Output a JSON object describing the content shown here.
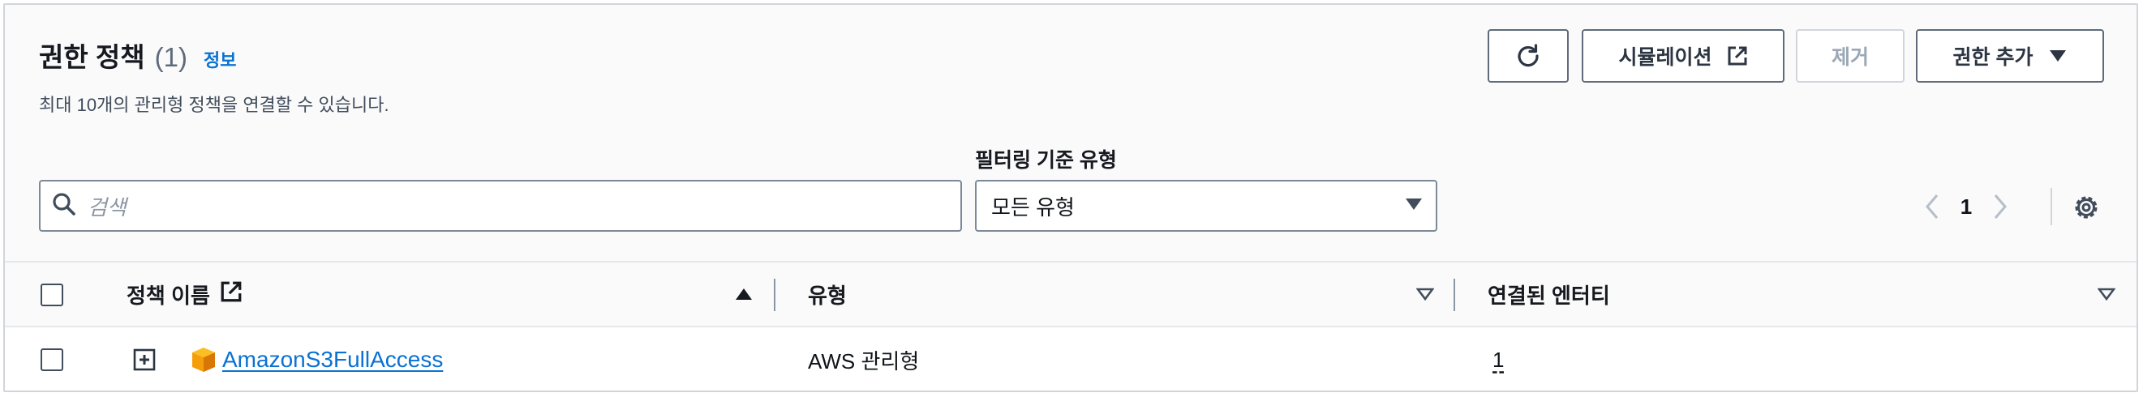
{
  "header": {
    "title": "권한 정책",
    "count": "(1)",
    "info_link": "정보",
    "description": "최대 10개의 관리형 정책을 연결할 수 있습니다."
  },
  "actions": {
    "refresh_icon": "refresh-icon",
    "simulation_label": "시뮬레이션",
    "remove_label": "제거",
    "add_label": "권한 추가"
  },
  "filter": {
    "search_placeholder": "검색",
    "type_label": "필터링 기준 유형",
    "type_value": "모든 유형"
  },
  "pagination": {
    "current_page": "1"
  },
  "table": {
    "columns": [
      {
        "label": "정책 이름",
        "sort": "ascending"
      },
      {
        "label": "유형",
        "sort": "none"
      },
      {
        "label": "연결된 엔터티",
        "sort": "none"
      }
    ],
    "rows": [
      {
        "name": "AmazonS3FullAccess",
        "type": "AWS 관리형",
        "attached_entities": "1"
      }
    ]
  },
  "colors": {
    "link": "#0972d3",
    "aws_icon": "#f59e0b",
    "border": "#5f6b7a"
  }
}
